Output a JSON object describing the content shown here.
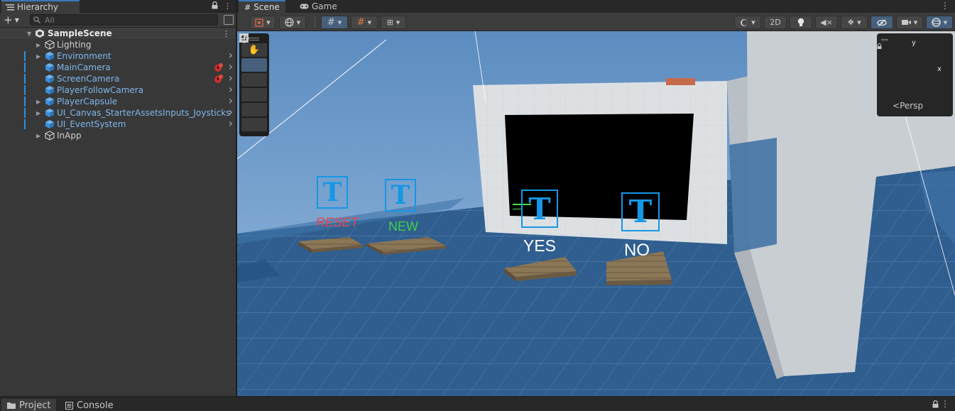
{
  "hierarchy": {
    "tab_label": "Hierarchy",
    "search_placeholder": "All",
    "scene": {
      "name": "SampleScene"
    },
    "items": [
      {
        "label": "Lighting",
        "type": "plain",
        "expandable": true,
        "chevron": false,
        "warning": false
      },
      {
        "label": "Environment",
        "type": "prefab",
        "expandable": true,
        "chevron": true,
        "warning": false
      },
      {
        "label": "MainCamera",
        "type": "prefab",
        "expandable": false,
        "chevron": true,
        "warning": true
      },
      {
        "label": "ScreenCamera",
        "type": "prefab",
        "expandable": false,
        "chevron": true,
        "warning": true
      },
      {
        "label": "PlayerFollowCamera",
        "type": "prefab",
        "expandable": false,
        "chevron": true,
        "warning": false
      },
      {
        "label": "PlayerCapsule",
        "type": "prefab",
        "expandable": true,
        "chevron": true,
        "warning": false
      },
      {
        "label": "UI_Canvas_StarterAssetsInputs_Joysticks",
        "type": "prefab",
        "expandable": true,
        "chevron": true,
        "warning": false
      },
      {
        "label": "UI_EventSystem",
        "type": "prefab",
        "expandable": false,
        "chevron": true,
        "warning": false
      },
      {
        "label": "InApp",
        "type": "plain",
        "expandable": true,
        "chevron": false,
        "warning": false
      }
    ]
  },
  "scene_view": {
    "tabs": [
      {
        "label": "Scene",
        "icon": "grid-icon",
        "active": true
      },
      {
        "label": "Game",
        "icon": "gamepad-icon",
        "active": false
      }
    ],
    "toolbar": {
      "mode_2d": "2D"
    },
    "gizmo": {
      "projection": "Persp",
      "axis_y": "y",
      "axis_x": "x"
    },
    "world_labels": [
      {
        "text": "RESET",
        "color": "#e8454f"
      },
      {
        "text": "NEW",
        "color": "#3fd14a"
      },
      {
        "text": "YES",
        "color": "#ffffff"
      },
      {
        "text": "NO",
        "color": "#ffffff"
      }
    ],
    "text_icon_glyph": "T"
  },
  "bottom_tabs": [
    {
      "label": "Project",
      "icon": "folder-icon",
      "active": true
    },
    {
      "label": "Console",
      "icon": "console-icon",
      "active": false
    }
  ],
  "colors": {
    "accent": "#3a79bb",
    "prefab_text": "#7eb6ec",
    "text_icon_blue": "#1597e5",
    "sky": "#5b88b8"
  }
}
